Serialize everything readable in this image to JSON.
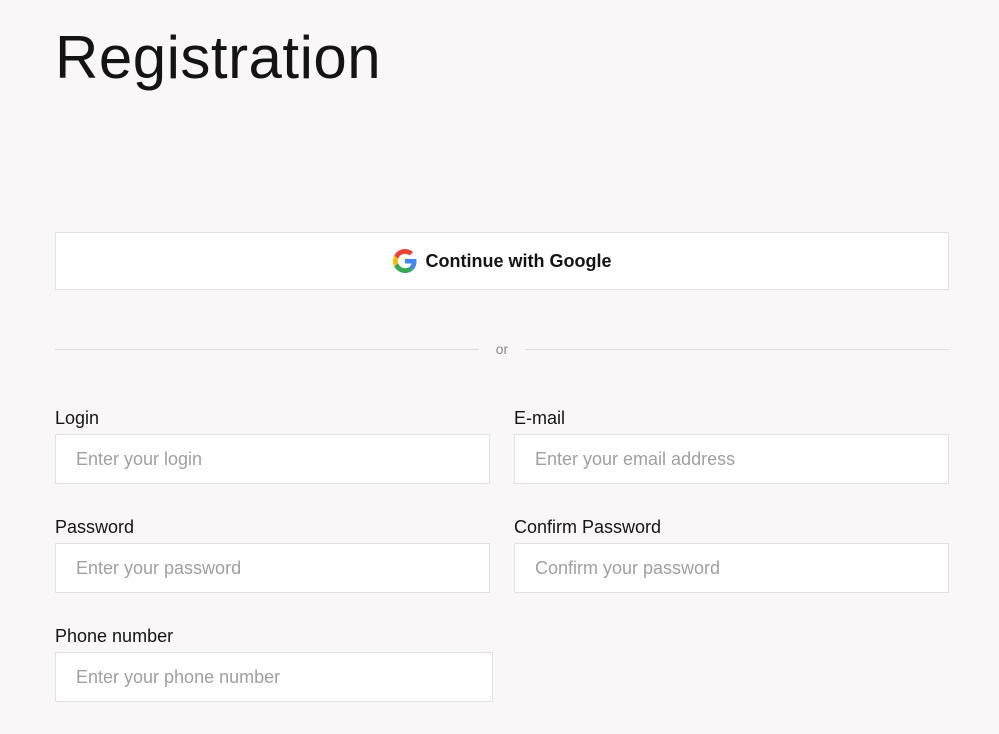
{
  "page": {
    "title": "Registration"
  },
  "google": {
    "label": "Continue with Google",
    "icon": "google-g-icon"
  },
  "divider": {
    "text": "or"
  },
  "form": {
    "login": {
      "label": "Login",
      "placeholder": "Enter your login",
      "value": ""
    },
    "email": {
      "label": "E-mail",
      "placeholder": "Enter your email address",
      "value": ""
    },
    "password": {
      "label": "Password",
      "placeholder": "Enter your password",
      "value": ""
    },
    "confirm_password": {
      "label": "Confirm Password",
      "placeholder": "Confirm your password",
      "value": ""
    },
    "phone": {
      "label": "Phone number",
      "placeholder": "Enter your phone number",
      "value": ""
    }
  },
  "colors": {
    "background": "#f9f7f7",
    "border": "#e1e1e1",
    "text": "#141414",
    "placeholder": "#a0a0a0",
    "google_blue": "#4285F4",
    "google_red": "#EA4335",
    "google_yellow": "#FBBC05",
    "google_green": "#34A853"
  }
}
